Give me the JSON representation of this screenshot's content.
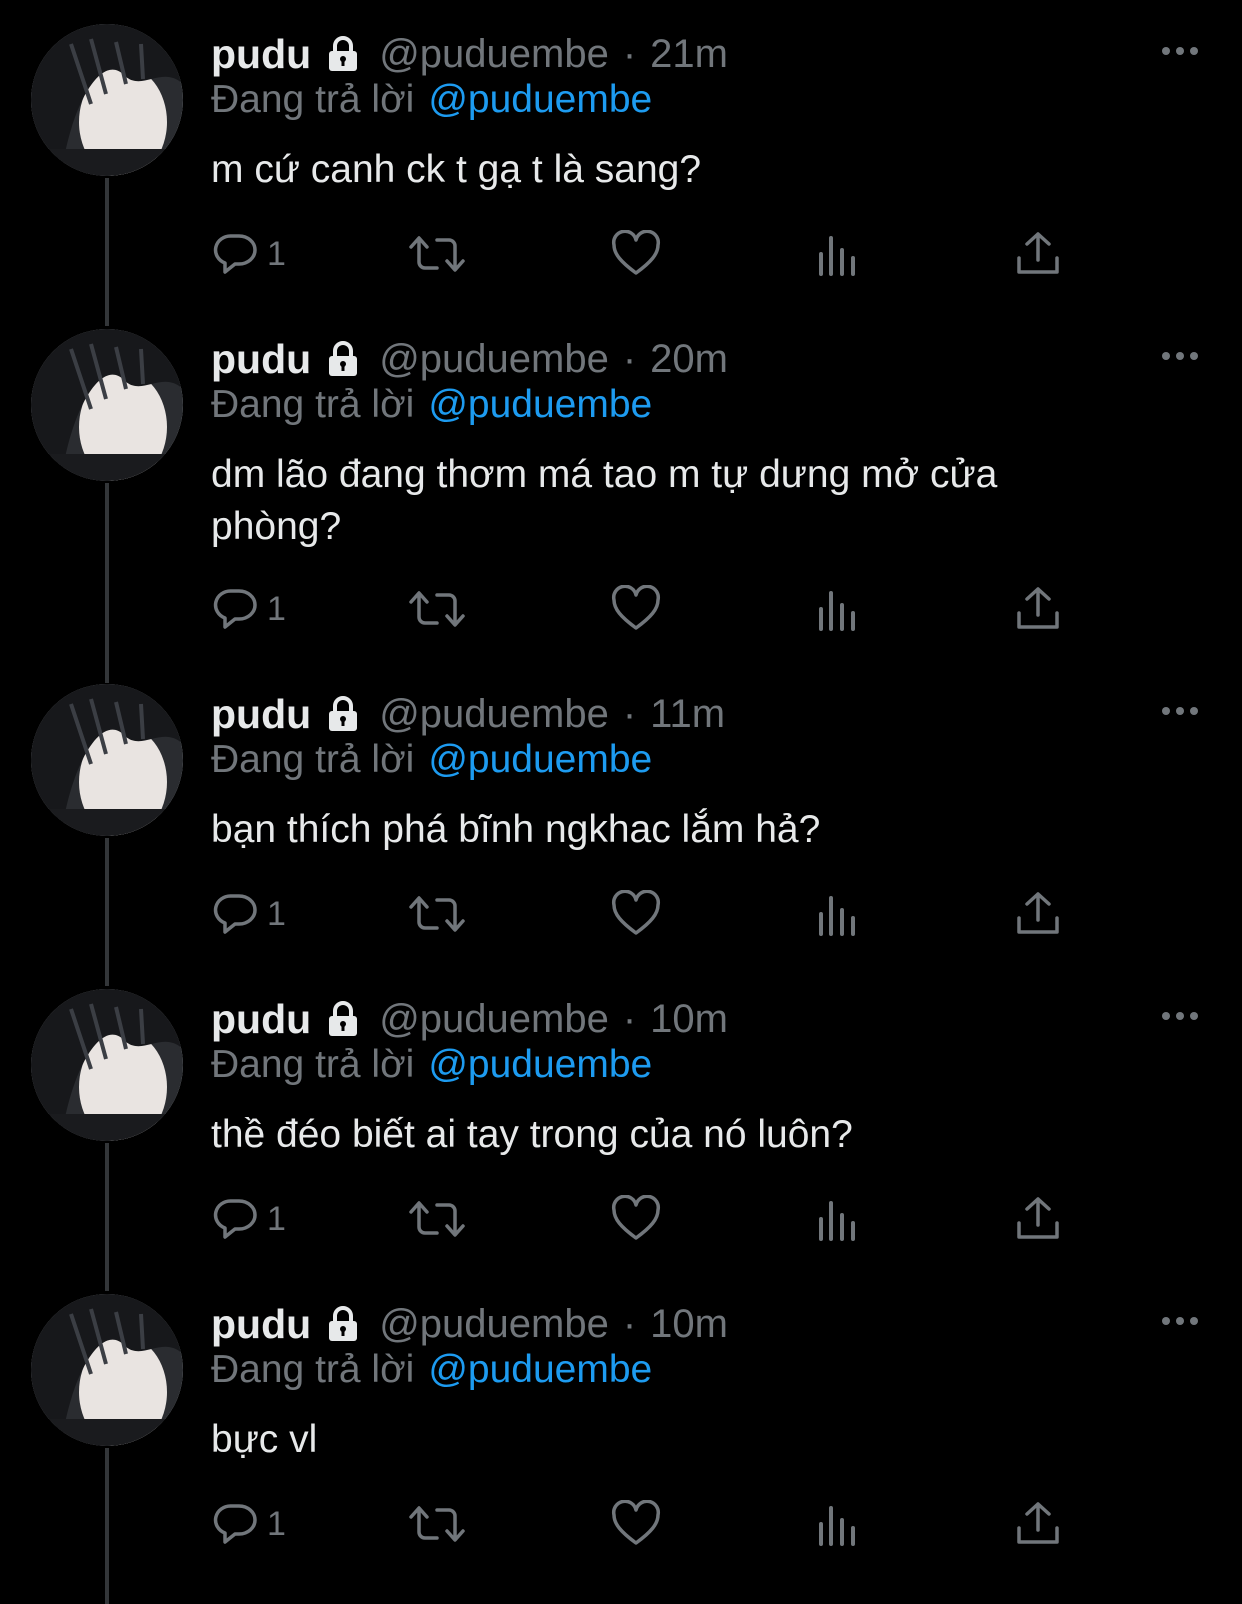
{
  "replying_prefix": "Đang trả lời",
  "colors": {
    "background": "#000000",
    "text": "#e7e9ea",
    "muted": "#71767b",
    "link": "#1d9bf0",
    "thread_line": "#333639"
  },
  "tweets": [
    {
      "name": "pudu",
      "handle": "@puduembe",
      "separator": "·",
      "time": "21m",
      "replying_to": "@puduembe",
      "text": "m cứ canh ck t gạ t là sang?",
      "reply_count": "1"
    },
    {
      "name": "pudu",
      "handle": "@puduembe",
      "separator": "·",
      "time": "20m",
      "replying_to": "@puduembe",
      "text": "dm lão đang thơm má tao m tự dưng mở cửa phòng?",
      "reply_count": "1"
    },
    {
      "name": "pudu",
      "handle": "@puduembe",
      "separator": "·",
      "time": "11m",
      "replying_to": "@puduembe",
      "text": "bạn thích phá bĩnh ngkhac lắm hả?",
      "reply_count": "1"
    },
    {
      "name": "pudu",
      "handle": "@puduembe",
      "separator": "·",
      "time": "10m",
      "replying_to": "@puduembe",
      "text": "thề đéo biết ai tay trong của nó luôn?",
      "reply_count": "1"
    },
    {
      "name": "pudu",
      "handle": "@puduembe",
      "separator": "·",
      "time": "10m",
      "replying_to": "@puduembe",
      "text": "bực vl",
      "reply_count": "1"
    }
  ],
  "icons": {
    "lock": "lock-icon",
    "more": "more-icon",
    "reply": "reply-icon",
    "retweet": "retweet-icon",
    "like": "like-icon",
    "views": "views-icon",
    "share": "share-icon"
  }
}
